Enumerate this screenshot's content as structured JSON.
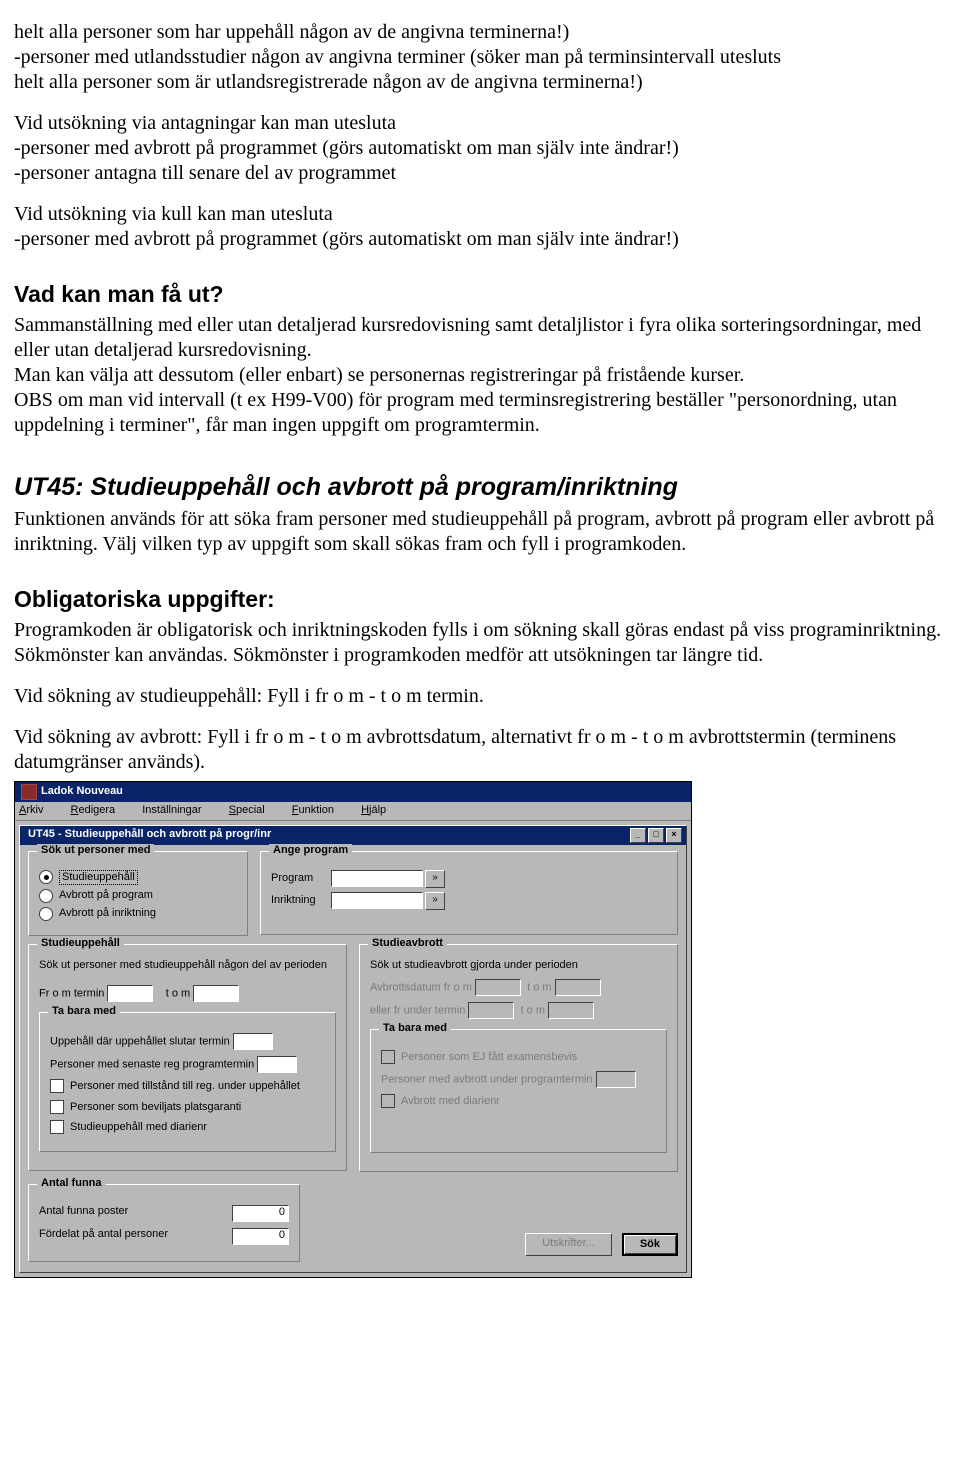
{
  "para1": "helt alla personer som har uppehåll någon av de angivna terminerna!)\n-personer med utlandsstudier någon av angivna terminer (söker man på terminsintervall utesluts\n helt alla personer som är utlandsregistrerade någon av de angivna terminerna!)",
  "para2": "Vid utsökning via antagningar kan man utesluta\n-personer med avbrott på programmet (görs automatiskt om man själv inte ändrar!)\n-personer antagna till senare del av programmet",
  "para3": "Vid utsökning via kull kan man utesluta\n-personer med avbrott på programmet (görs automatiskt om man själv inte ändrar!)",
  "h_vad": "Vad kan man få ut?",
  "para_vad": "Sammanställning med eller utan detaljerad kursredovisning samt detaljlistor i fyra olika sorteringsordningar, med eller utan detaljerad kursredovisning.\nMan kan välja att dessutom (eller enbart) se personernas registreringar på fristående kurser.\nOBS om man vid intervall (t ex H99-V00) för program med terminsregistrering beställer \"personordning, utan uppdelning i terminer\", får man ingen uppgift om programtermin.",
  "h_ut45": "UT45: Studieuppehåll och avbrott på program/inriktning",
  "para_ut45": "Funktionen används för att söka fram personer med studieuppehåll på program, avbrott på program eller avbrott på inriktning. Välj vilken typ av uppgift som skall sökas fram och fyll i programkoden.",
  "h_oblig": "Obligatoriska uppgifter:",
  "para_oblig": "Programkoden är obligatorisk och inriktningskoden fylls i om sökning skall göras endast på viss programinriktning. Sökmönster kan användas. Sökmönster i programkoden medför att utsökningen tar längre tid.",
  "para_upp": "Vid sökning av studieuppehåll: Fyll i fr o m - t o m termin.",
  "para_avb": "Vid sökning av avbrott: Fyll i fr o m - t o m avbrottsdatum, alternativt fr o m - t o m avbrottstermin (terminens datumgränser används).",
  "ladok": {
    "app_title": "Ladok Nouveau",
    "menu": {
      "arkiv": "Arkiv",
      "redigera": "Redigera",
      "installningar": "Inställningar",
      "special": "Special",
      "funktion": "Funktion",
      "hjalp": "Hjälp"
    },
    "inner_title": "UT45 - Studieuppehåll och avbrott på progr/inr",
    "groups": {
      "sok": {
        "legend": "Sök ut personer med",
        "opt1": "Studieuppehåll",
        "opt2": "Avbrott på program",
        "opt3": "Avbrott på inriktning"
      },
      "ange": {
        "legend": "Ange program",
        "program": "Program",
        "inriktning": "Inriktning"
      },
      "stu_upp": {
        "legend": "Studieuppehåll",
        "text": "Sök ut personer med studieuppehåll någon del av perioden",
        "from": "Fr o m termin",
        "tom": "t o m"
      },
      "stu_avb": {
        "legend": "Studieavbrott",
        "text": "Sök ut studieavbrott gjorda under perioden",
        "d1a": "Avbrottsdatum fr o m",
        "d1b": "t o m",
        "d2a": "eller fr under termin",
        "d2b": "t o m"
      },
      "tabara1": {
        "legend": "Ta bara med",
        "l1": "Uppehåll där uppehållet slutar termin",
        "l2": "Personer med senaste reg programtermin",
        "l3": "Personer med tillstånd till reg. under uppehållet",
        "l4": "Personer som beviljats platsgaranti",
        "l5": "Studieuppehåll med diarienr"
      },
      "tabara2": {
        "legend": "Ta bara med",
        "l1": "Personer som EJ fått examensbevis",
        "l2": "Personer med avbrott under programtermin",
        "l3": "Avbrott med diarienr"
      },
      "antal": {
        "legend": "Antal funna",
        "l1": "Antal funna poster",
        "l2": "Fördelat på antal personer",
        "v": "0"
      },
      "btn_print": "Utskrifter...",
      "btn_search": "Sök"
    }
  }
}
